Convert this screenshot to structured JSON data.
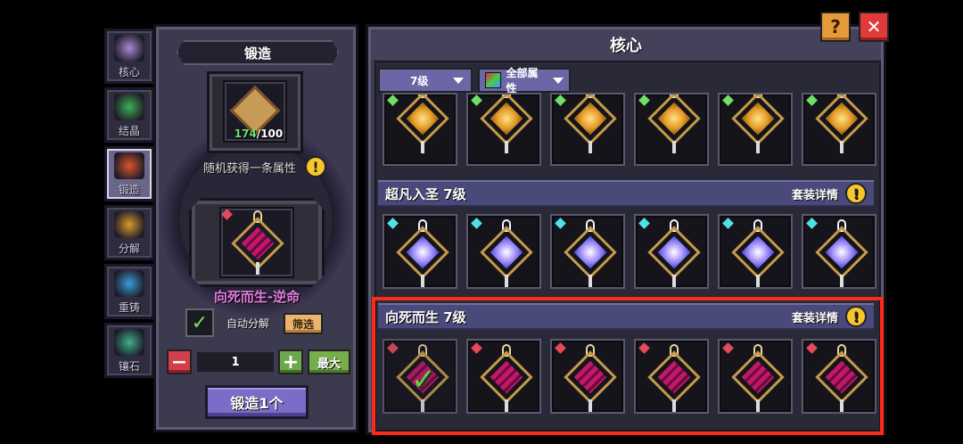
{
  "tabs": [
    {
      "label": "核心",
      "icon": "core-icon",
      "active": false
    },
    {
      "label": "结晶",
      "icon": "crystal-icon",
      "active": false
    },
    {
      "label": "锻造",
      "icon": "anvil-icon",
      "active": true
    },
    {
      "label": "分解",
      "icon": "decompose-icon",
      "active": false
    },
    {
      "label": "重铸",
      "icon": "recast-icon",
      "active": false
    },
    {
      "label": "镶石",
      "icon": "inlay-icon",
      "active": false
    }
  ],
  "forge": {
    "title": "锻造",
    "material_current": "174",
    "material_total": "/100",
    "random_hint": "随机获得一条属性",
    "result_name": "向死而生-逆命",
    "auto_decompose_label": "自动分解",
    "auto_decompose_checked": true,
    "filter_label": "筛选",
    "quantity": "1",
    "max_label": "最大",
    "forge_button": "锻造1个"
  },
  "core_panel": {
    "title": "核心",
    "level_filter": "7级",
    "attr_filter": "全部属性",
    "detail_label": "套装详情",
    "help_glyph": "!",
    "sets": [
      {
        "name": "",
        "style": "gold",
        "items": 6
      },
      {
        "name": "超凡入圣 7级",
        "style": "blue",
        "items": 6
      },
      {
        "name": "向死而生 7级",
        "style": "pink",
        "items": 6,
        "first_selected": true
      }
    ]
  },
  "top_buttons": {
    "help": "?",
    "close": "✕"
  },
  "colors": {
    "accent_purple": "#7b6cc7",
    "highlight_red": "#ff2a14",
    "pink_name": "#e37ce0",
    "green_count": "#6fe06a"
  }
}
